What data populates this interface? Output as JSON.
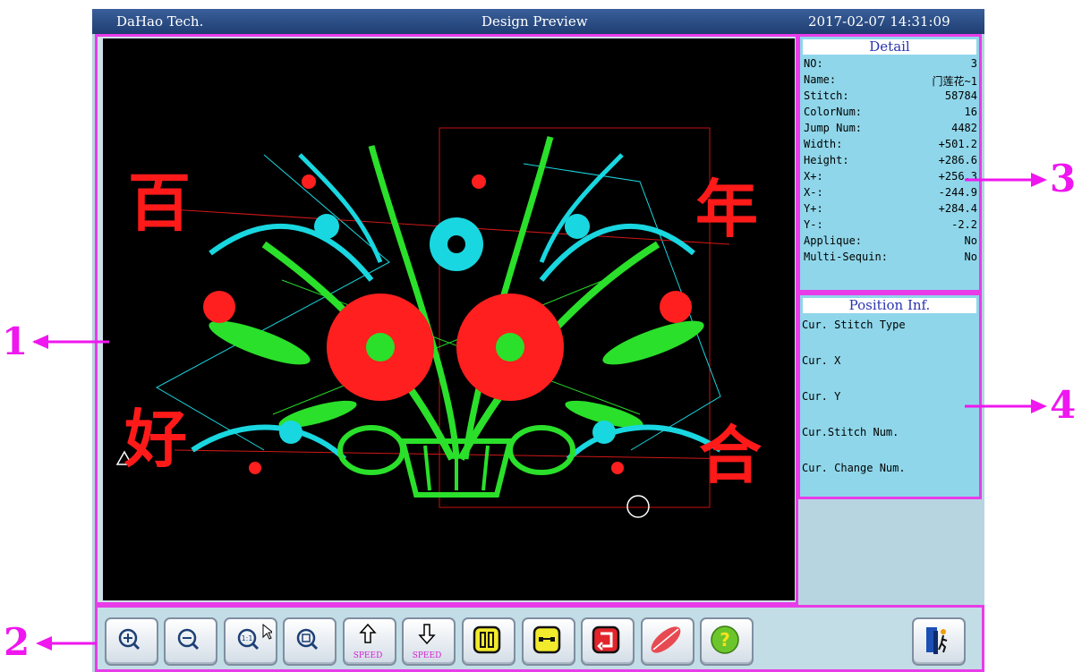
{
  "titlebar": {
    "left": "DaHao Tech.",
    "center": "Design Preview",
    "right": "2017-02-07 14:31:09"
  },
  "design_chars": {
    "top_left": "百",
    "top_right": "年",
    "bottom_left": "好",
    "bottom_right": "合"
  },
  "detail": {
    "title": "Detail",
    "rows": [
      {
        "label": "NO:",
        "value": "3"
      },
      {
        "label": "Name:",
        "value": "门莲花~1"
      },
      {
        "label": "Stitch:",
        "value": "58784"
      },
      {
        "label": "ColorNum:",
        "value": "16"
      },
      {
        "label": "Jump Num:",
        "value": "4482"
      },
      {
        "label": "Width:",
        "value": "+501.2"
      },
      {
        "label": "Height:",
        "value": "+286.6"
      },
      {
        "label": "X+:",
        "value": "+256.3"
      },
      {
        "label": "X-:",
        "value": "-244.9"
      },
      {
        "label": "Y+:",
        "value": "+284.4"
      },
      {
        "label": "Y-:",
        "value": "-2.2"
      },
      {
        "label": "Applique:",
        "value": "No"
      },
      {
        "label": "Multi-Sequin:",
        "value": "No"
      }
    ]
  },
  "position": {
    "title": "Position Inf.",
    "labels": [
      "Cur. Stitch Type",
      "Cur. X",
      "Cur. Y",
      "Cur.Stitch Num.",
      "Cur. Change Num."
    ]
  },
  "toolbar": {
    "speed_up_label": "SPEED",
    "speed_down_label": "SPEED"
  },
  "annotations": {
    "a1": "1",
    "a2": "2",
    "a3": "3",
    "a4": "4"
  },
  "colors": {
    "accent_border": "#e83ce8",
    "title_bar": "#1f3e72",
    "panel_bg": "#8fd6ea",
    "canvas_bg": "#000000"
  }
}
